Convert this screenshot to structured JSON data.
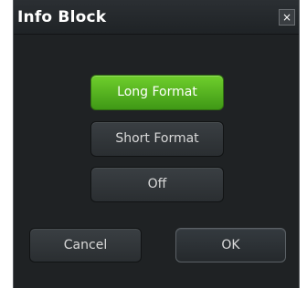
{
  "dialog": {
    "title": "Info Block",
    "close_label": "×"
  },
  "options": {
    "long_label": "Long Format",
    "short_label": "Short Format",
    "off_label": "Off",
    "selected": "Long Format"
  },
  "footer": {
    "cancel_label": "Cancel",
    "ok_label": "OK"
  },
  "colors": {
    "selected_green": "#5cb82a",
    "panel_bg": "#1f2224",
    "button_bg": "#2f3437"
  },
  "icons": {
    "close": "close-icon"
  }
}
